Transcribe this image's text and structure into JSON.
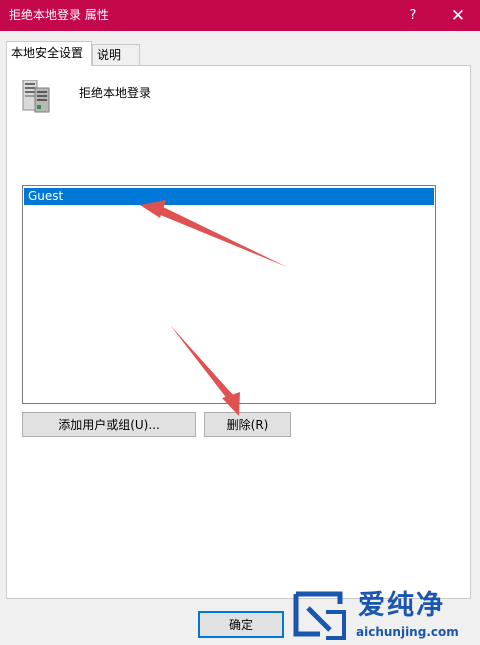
{
  "window": {
    "title": "拒绝本地登录 属性",
    "help_label": "?",
    "close_label": "✕",
    "titlebar_color": "#c5084b"
  },
  "tabs": [
    {
      "label": "本地安全设置",
      "active": true
    },
    {
      "label": "说明",
      "active": false
    }
  ],
  "policy": {
    "icon": "server-computer-icon",
    "title": "拒绝本地登录"
  },
  "list": {
    "items": [
      {
        "label": "Guest",
        "selected": true
      }
    ],
    "selection_color": "#0078d7"
  },
  "buttons": {
    "add": "添加用户或组(U)...",
    "remove": "删除(R)",
    "ok": "确定"
  },
  "annotations": {
    "arrow_color": "#e05252",
    "arrows": [
      "arrow-to-guest",
      "arrow-to-remove-button"
    ]
  },
  "watermark": {
    "brand_cn": "爱纯净",
    "url": "aichunjing.com",
    "color": "#1a56b0"
  }
}
